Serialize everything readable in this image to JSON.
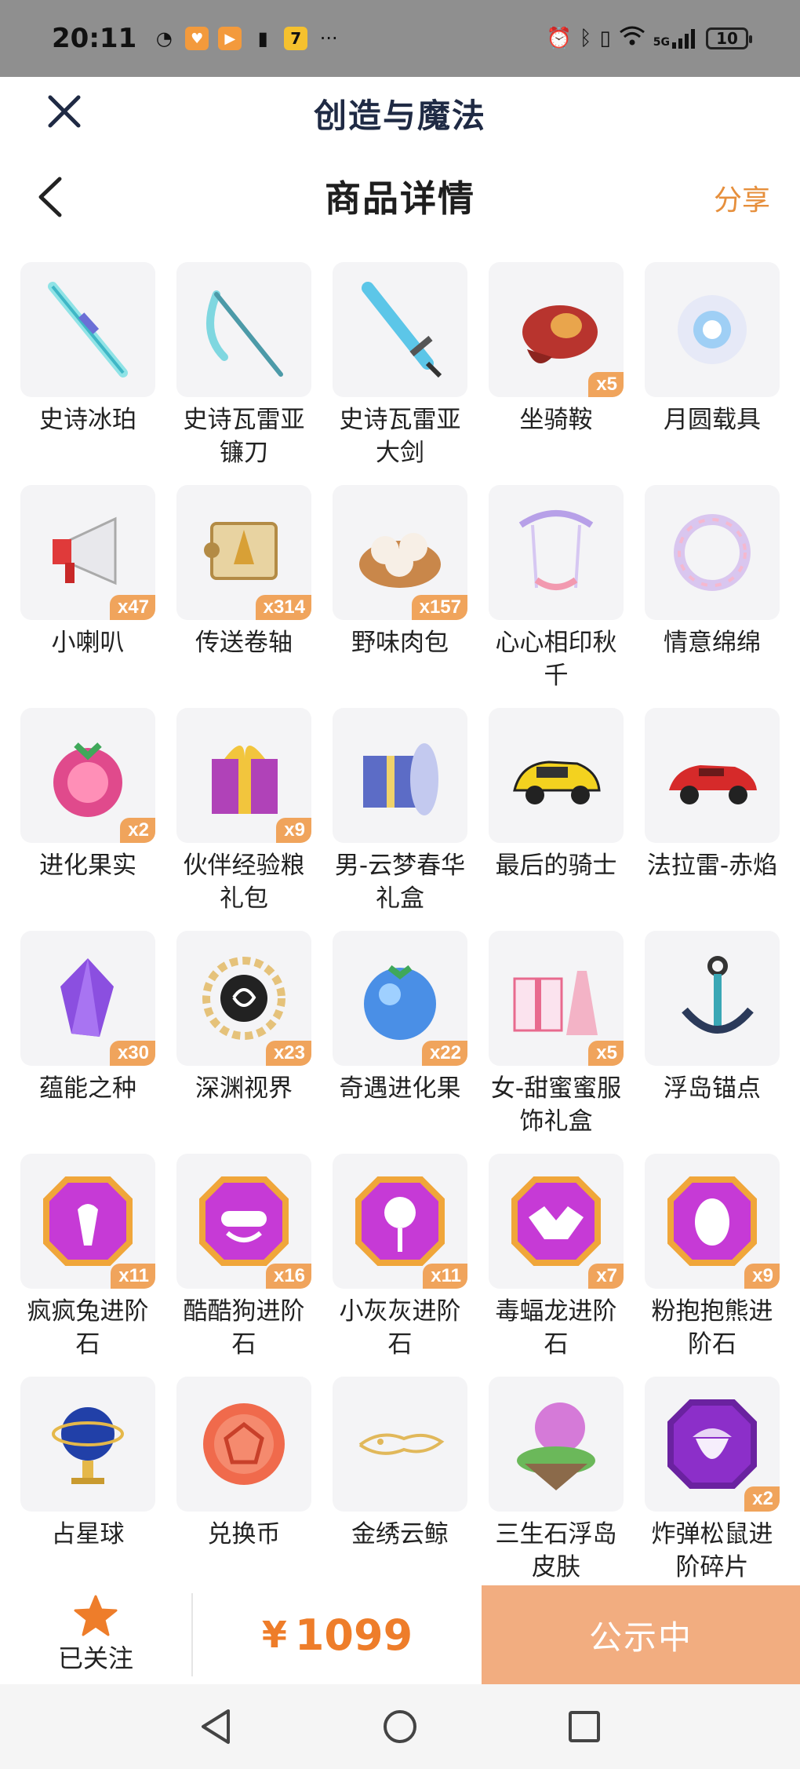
{
  "status_bar": {
    "time": "20:11",
    "icons": [
      "timer-icon",
      "shield-app-icon",
      "video-app-icon",
      "battery-saver-icon",
      "game-app-icon",
      "more-dots-icon"
    ],
    "more": "···",
    "right_icons": [
      "alarm-icon",
      "bluetooth-icon",
      "vibrate-icon",
      "wifi-icon",
      "5g-signal-icon"
    ],
    "network": "5G",
    "battery": "10"
  },
  "app_bar": {
    "title": "创造与魔法"
  },
  "header": {
    "title": "商品详情",
    "share": "分享"
  },
  "items": [
    {
      "name": "史诗冰珀",
      "qty": "",
      "icon": "ice-sword-icon"
    },
    {
      "name": "史诗瓦雷亚镰刀",
      "qty": "",
      "icon": "scythe-icon"
    },
    {
      "name": "史诗瓦雷亚大剑",
      "qty": "",
      "icon": "greatsword-icon"
    },
    {
      "name": "坐骑鞍",
      "qty": "x5",
      "icon": "saddle-icon"
    },
    {
      "name": "月圆载具",
      "qty": "",
      "icon": "moon-vehicle-icon"
    },
    {
      "name": "小喇叭",
      "qty": "x47",
      "icon": "megaphone-icon"
    },
    {
      "name": "传送卷轴",
      "qty": "x314",
      "icon": "scroll-icon"
    },
    {
      "name": "野味肉包",
      "qty": "x157",
      "icon": "meat-bun-icon"
    },
    {
      "name": "心心相印秋千",
      "qty": "",
      "icon": "swing-icon"
    },
    {
      "name": "情意绵绵",
      "qty": "",
      "icon": "wreath-icon"
    },
    {
      "name": "进化果实",
      "qty": "x2",
      "icon": "berry-icon"
    },
    {
      "name": "伙伴经验粮礼包",
      "qty": "x9",
      "icon": "gift-box-icon"
    },
    {
      "name": "男-云梦春华礼盒",
      "qty": "",
      "icon": "costume-gift-icon"
    },
    {
      "name": "最后的骑士",
      "qty": "",
      "icon": "yellow-car-icon"
    },
    {
      "name": "法拉雷-赤焰",
      "qty": "",
      "icon": "red-car-icon"
    },
    {
      "name": "蕴能之种",
      "qty": "x30",
      "icon": "crystal-icon"
    },
    {
      "name": "深渊视界",
      "qty": "x23",
      "icon": "abyss-sun-icon"
    },
    {
      "name": "奇遇进化果",
      "qty": "x22",
      "icon": "blue-fruit-icon"
    },
    {
      "name": "女-甜蜜蜜服饰礼盒",
      "qty": "x5",
      "icon": "dress-gift-icon"
    },
    {
      "name": "浮岛锚点",
      "qty": "",
      "icon": "anchor-icon"
    },
    {
      "name": "疯疯兔进阶石",
      "qty": "x11",
      "icon": "rabbit-gem-icon"
    },
    {
      "name": "酷酷狗进阶石",
      "qty": "x16",
      "icon": "dog-gem-icon"
    },
    {
      "name": "小灰灰进阶石",
      "qty": "x11",
      "icon": "lollipop-gem-icon"
    },
    {
      "name": "毒蝠龙进阶石",
      "qty": "x7",
      "icon": "bat-gem-icon"
    },
    {
      "name": "粉抱抱熊进阶石",
      "qty": "x9",
      "icon": "egg-gem-icon"
    },
    {
      "name": "占星球",
      "qty": "",
      "icon": "globe-icon"
    },
    {
      "name": "兑换币",
      "qty": "",
      "icon": "coin-icon"
    },
    {
      "name": "金绣云鲸",
      "qty": "",
      "icon": "golden-whale-icon"
    },
    {
      "name": "三生石浮岛皮肤",
      "qty": "",
      "icon": "floating-island-icon"
    },
    {
      "name": "炸弹松鼠进阶碎片",
      "qty": "x2",
      "icon": "acorn-gem-icon"
    }
  ],
  "bottom": {
    "follow_label": "已关注",
    "price_symbol": "¥",
    "price": "1099",
    "status_button": "公示中"
  },
  "colors": {
    "accent": "#EE7D2A",
    "status_button": "#F2AD80",
    "qty_badge": "#F0A45C",
    "title": "#1F2A44"
  }
}
